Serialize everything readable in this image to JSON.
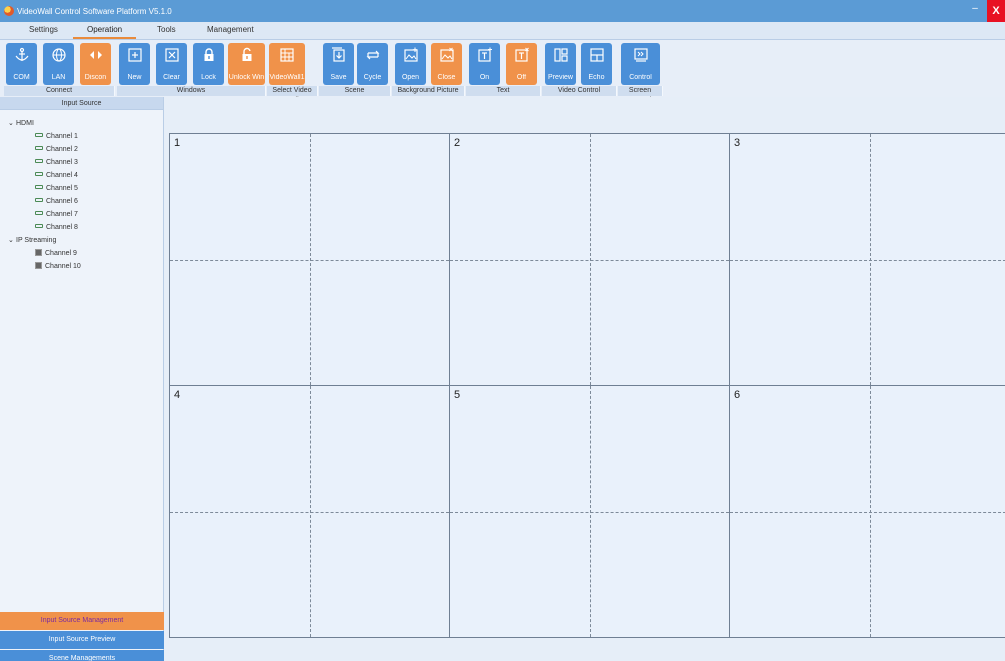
{
  "window": {
    "title": "VideoWall Control Software Platform V5.1.0",
    "minimize_label": "–",
    "close_label": "X"
  },
  "menu": {
    "tabs": [
      "Settings",
      "Operation",
      "Tools",
      "Management"
    ],
    "active": "Operation"
  },
  "ribbon": {
    "buttons": [
      {
        "label": "COM",
        "icon": "anchor-icon",
        "color": "blue"
      },
      {
        "label": "LAN",
        "icon": "globe-icon",
        "color": "blue"
      },
      {
        "label": "Discon",
        "icon": "disconnect-arrows-icon",
        "color": "orange"
      },
      {
        "label": "New",
        "icon": "new-window-icon",
        "color": "blue"
      },
      {
        "label": "Clear",
        "icon": "clear-window-icon",
        "color": "blue"
      },
      {
        "label": "Lock",
        "icon": "lock-icon",
        "color": "blue"
      },
      {
        "label": "Unlock Win",
        "icon": "unlock-icon",
        "color": "orange"
      },
      {
        "label": "VideoWall1",
        "icon": "video-wall-grid-icon",
        "color": "orange"
      },
      {
        "label": "Save",
        "icon": "save-scene-icon",
        "color": "blue"
      },
      {
        "label": "Cycle",
        "icon": "cycle-icon",
        "color": "blue"
      },
      {
        "label": "Open",
        "icon": "open-picture-icon",
        "color": "blue"
      },
      {
        "label": "Close",
        "icon": "close-picture-icon",
        "color": "orange"
      },
      {
        "label": "On",
        "icon": "text-on-icon",
        "color": "blue"
      },
      {
        "label": "Off",
        "icon": "text-off-icon",
        "color": "orange"
      },
      {
        "label": "Preview",
        "icon": "preview-icon",
        "color": "blue"
      },
      {
        "label": "Echo",
        "icon": "echo-icon",
        "color": "blue"
      },
      {
        "label": "Control",
        "icon": "screen-control-icon",
        "color": "blue"
      }
    ],
    "groups": [
      "Connect",
      "Windows",
      "Select Video Wall",
      "Scene",
      "Background Picture",
      "Text",
      "Video Control",
      "Screen Control"
    ]
  },
  "left_panel": {
    "header": "Input Source",
    "groups": [
      {
        "label": "HDMI",
        "channels": [
          "Channel 1",
          "Channel 2",
          "Channel 3",
          "Channel 4",
          "Channel 5",
          "Channel 6",
          "Channel 7",
          "Channel 8"
        ]
      },
      {
        "label": "IP Streaming",
        "channels": [
          "Channel 9",
          "Channel 10"
        ]
      }
    ],
    "bottom_tabs": [
      "Input Source Management",
      "Input Source Preview",
      "Scene Managements"
    ]
  },
  "wall": {
    "screens": [
      "1",
      "2",
      "3",
      "4",
      "5",
      "6"
    ]
  },
  "colors": {
    "titlebar": "#5b9bd5",
    "button_blue": "#4a8fd8",
    "button_orange": "#f0924a",
    "close_red": "#e81123"
  }
}
